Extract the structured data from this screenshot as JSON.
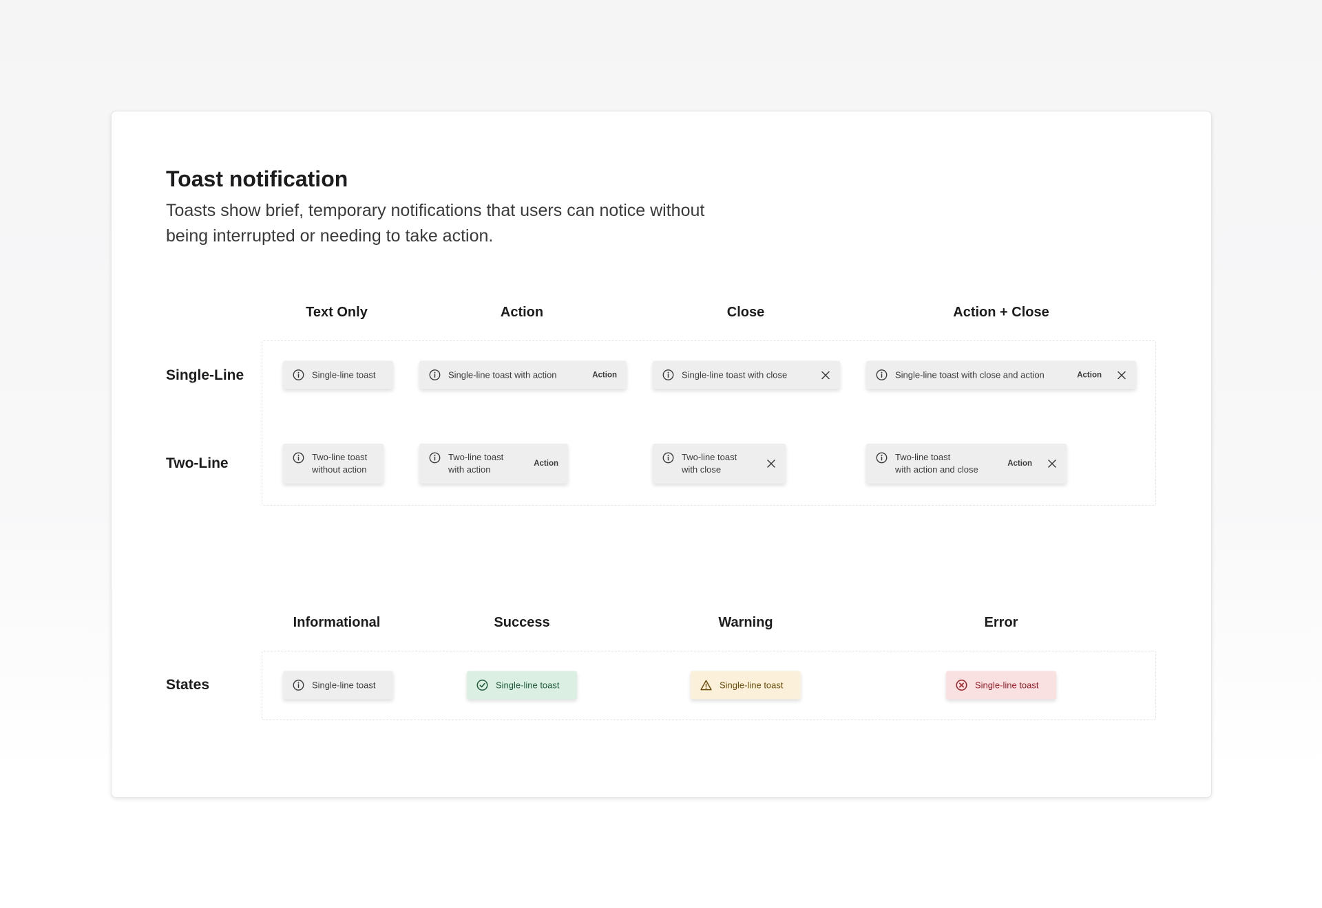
{
  "page": {
    "title": "Toast notification",
    "description": "Toasts show brief, temporary notifications that users can notice without being interrupted or needing to take action."
  },
  "variants": {
    "columns": [
      "Text Only",
      "Action",
      "Close",
      "Action + Close"
    ],
    "rows": [
      "Single-Line",
      "Two-Line"
    ],
    "single": {
      "text_only": "Single-line toast",
      "action": "Single-line toast with action",
      "close": "Single-line toast with close",
      "action_close": "Single-line toast with close and action"
    },
    "two": {
      "text_only": [
        "Two-line toast",
        "without action"
      ],
      "action": [
        "Two-line toast",
        "with action"
      ],
      "close": [
        "Two-line toast",
        "with close"
      ],
      "action_close": [
        "Two-line toast",
        "with action and close"
      ]
    },
    "action_label": "Action"
  },
  "states": {
    "columns": [
      "Informational",
      "Success",
      "Warning",
      "Error"
    ],
    "row_label": "States",
    "toast_text": "Single-line toast"
  },
  "icons": {
    "info": "info-circle-icon",
    "success": "check-circle-icon",
    "warning": "warning-triangle-icon",
    "error": "x-circle-icon",
    "close": "close-icon"
  },
  "colors": {
    "neutral_bg": "#eeeeef",
    "success_bg": "#dcefe3",
    "success_fg": "#1d5a36",
    "warning_bg": "#fbf1da",
    "warning_fg": "#6b4e0b",
    "error_bg": "#f9e1e2",
    "error_fg": "#9a1d25"
  }
}
